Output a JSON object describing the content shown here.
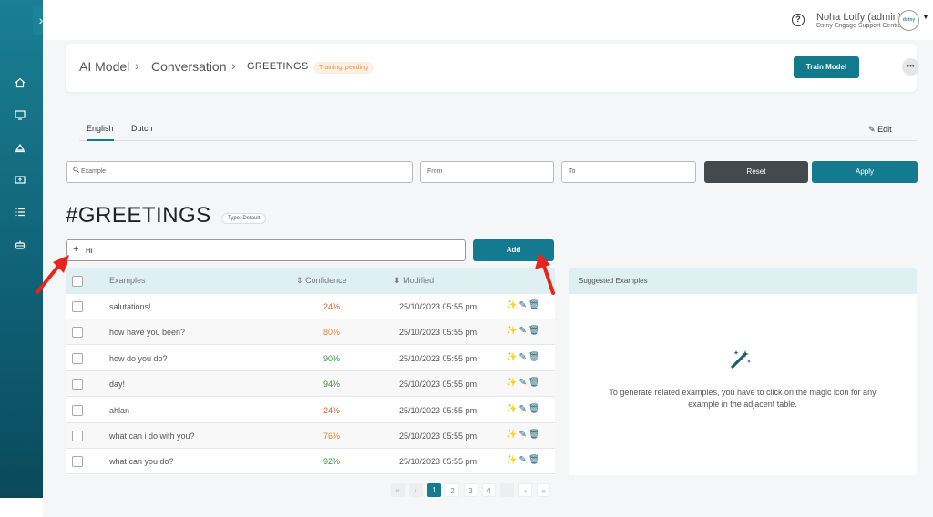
{
  "sidebar": {
    "toggle": "›",
    "icons": [
      "home-icon",
      "monitor-icon",
      "triangle-icon",
      "folder-upload-icon",
      "list-icon",
      "bot-icon"
    ]
  },
  "topbar": {
    "help": "?",
    "user_name": "Noha Lotfy (admin)",
    "user_org": "Dstny Engage Support Centre",
    "avatar_text": "dstny"
  },
  "breadcrumb": {
    "items": [
      "AI Model",
      "Conversation",
      "GREETINGS"
    ],
    "separator": "›",
    "status": "Training: pending"
  },
  "header_actions": {
    "train_label": "Train Model",
    "more_label": "•••"
  },
  "tabs": [
    {
      "label": "English",
      "active": true
    },
    {
      "label": "Dutch",
      "active": false
    }
  ],
  "edit_label": "Edit",
  "filters": {
    "example_placeholder": "Example",
    "from_placeholder": "From",
    "to_placeholder": "To",
    "reset_label": "Reset",
    "apply_label": "Apply"
  },
  "intent": {
    "title": "#GREETINGS",
    "type_badge": "Type: Default"
  },
  "add_example": {
    "plus": "+",
    "value": "Hi",
    "button": "Add"
  },
  "table": {
    "headers": {
      "examples": "Examples",
      "confidence": "Confidence",
      "modified": "Modified"
    },
    "sort_icon_conf": "⇕",
    "sort_icon_mod": "⬍",
    "rows": [
      {
        "example": "salutations!",
        "confidence": "24%",
        "modified": "25/10/2023 05:55 pm",
        "color": "#d9622b"
      },
      {
        "example": "how have you been?",
        "confidence": "80%",
        "modified": "25/10/2023 05:55 pm",
        "color": "#e08a3a"
      },
      {
        "example": "how do you do?",
        "confidence": "90%",
        "modified": "25/10/2023 05:55 pm",
        "color": "#3a8f3a"
      },
      {
        "example": "day!",
        "confidence": "94%",
        "modified": "25/10/2023 05:55 pm",
        "color": "#3a8f3a"
      },
      {
        "example": "ahlan",
        "confidence": "24%",
        "modified": "25/10/2023 05:55 pm",
        "color": "#d9622b"
      },
      {
        "example": "what can i do with you?",
        "confidence": "76%",
        "modified": "25/10/2023 05:55 pm",
        "color": "#e08a3a"
      },
      {
        "example": "what can you do?",
        "confidence": "92%",
        "modified": "25/10/2023 05:55 pm",
        "color": "#3a8f3a"
      }
    ]
  },
  "suggested": {
    "title": "Suggested Examples",
    "message": "To generate related examples, you have to click on the magic icon for any example in the adjacent table."
  },
  "pagination": {
    "first": "«",
    "prev": "‹",
    "pages": [
      "1",
      "2",
      "3",
      "4"
    ],
    "ellipsis": "...",
    "next": "›",
    "last": "»",
    "current": "1"
  },
  "colors": {
    "brand": "#137a8f",
    "annotation_arrow": "#e8241c"
  }
}
